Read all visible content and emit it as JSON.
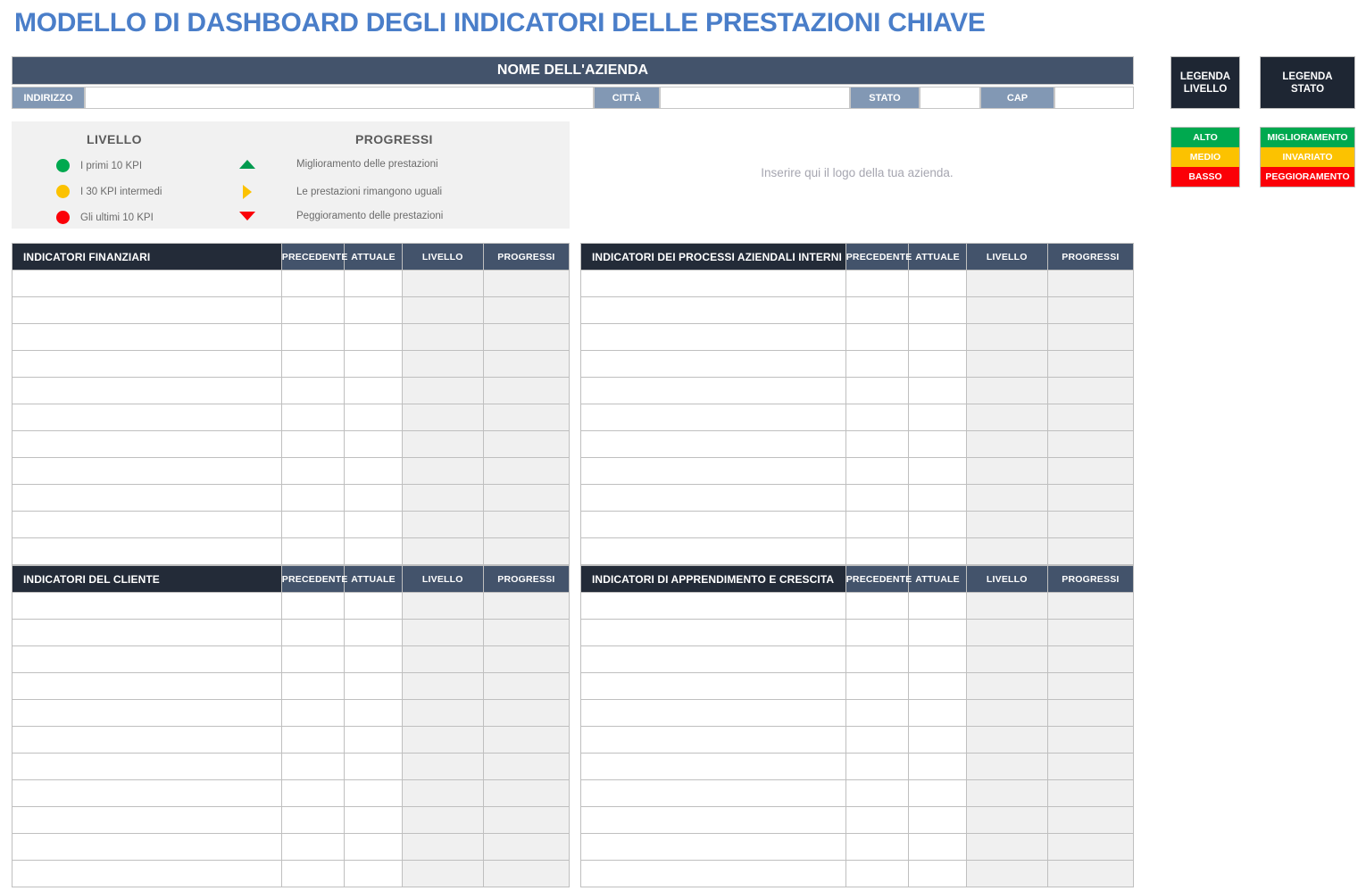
{
  "page_title": "MODELLO DI DASHBOARD DEGLI INDICATORI DELLE PRESTAZIONI CHIAVE",
  "company": {
    "name_bar": "NOME DELL'AZIENDA",
    "fields": [
      {
        "label": "INDIRIZZO",
        "value": ""
      },
      {
        "label": "CITTÀ",
        "value": ""
      },
      {
        "label": "STATO",
        "value": ""
      },
      {
        "label": "CAP",
        "value": ""
      }
    ]
  },
  "logo_placeholder": "Inserire qui il logo della tua azienda.",
  "legend": {
    "livello_heading": "LIVELLO",
    "progressi_heading": "PROGRESSI",
    "livello_items": [
      {
        "color": "#00a94f",
        "label": "I primi 10 KPI"
      },
      {
        "color": "#fcc200",
        "label": "I 30 KPI intermedi"
      },
      {
        "color": "#fb0007",
        "label": "Gli ultimi 10 KPI"
      }
    ],
    "progressi_items": [
      {
        "icon": "triangle-up-icon",
        "color": "#009a4e",
        "label": "Miglioramento delle prestazioni"
      },
      {
        "icon": "triangle-right-icon",
        "color": "#fcc200",
        "label": "Le prestazioni rimangono uguali"
      },
      {
        "icon": "triangle-down-icon",
        "color": "#fb0007",
        "label": "Peggioramento delle prestazioni"
      }
    ]
  },
  "right_legends": [
    {
      "title_line1": "LEGENDA",
      "title_line2": "LIVELLO",
      "swatches": [
        {
          "label": "ALTO",
          "color": "#00a94f"
        },
        {
          "label": "MEDIO",
          "color": "#fcc200"
        },
        {
          "label": "BASSO",
          "color": "#fb0007"
        }
      ]
    },
    {
      "title_line1": "LEGENDA",
      "title_line2": "STATO",
      "swatches": [
        {
          "label": "MIGLIORAMENTO",
          "color": "#00a94f"
        },
        {
          "label": "INVARIATO",
          "color": "#fcc200"
        },
        {
          "label": "PEGGIORAMENTO",
          "color": "#fb0007"
        }
      ]
    }
  ],
  "common_columns": [
    "PRECEDENTE",
    "ATTUALE",
    "LIVELLO",
    "PROGRESSI"
  ],
  "tables": [
    {
      "id": "finanziari",
      "title": "INDICATORI FINANZIARI",
      "row_count": 11
    },
    {
      "id": "processi",
      "title": "INDICATORI DEI PROCESSI AZIENDALI INTERNI",
      "row_count": 11
    },
    {
      "id": "cliente",
      "title": "INDICATORI DEL CLIENTE",
      "row_count": 11
    },
    {
      "id": "apprendimento",
      "title": "INDICATORI DI APPRENDIMENTO E CRESCITA",
      "row_count": 11
    }
  ],
  "colors": {
    "title_blue": "#4a7ec9",
    "header_slate": "#43536b",
    "category_dark": "#232b38",
    "label_blue_gray": "#8298b4",
    "panel_gray": "#f1f1f1",
    "cell_shaded": "#f0f0f0",
    "legend_box_dark": "#1e2633"
  }
}
